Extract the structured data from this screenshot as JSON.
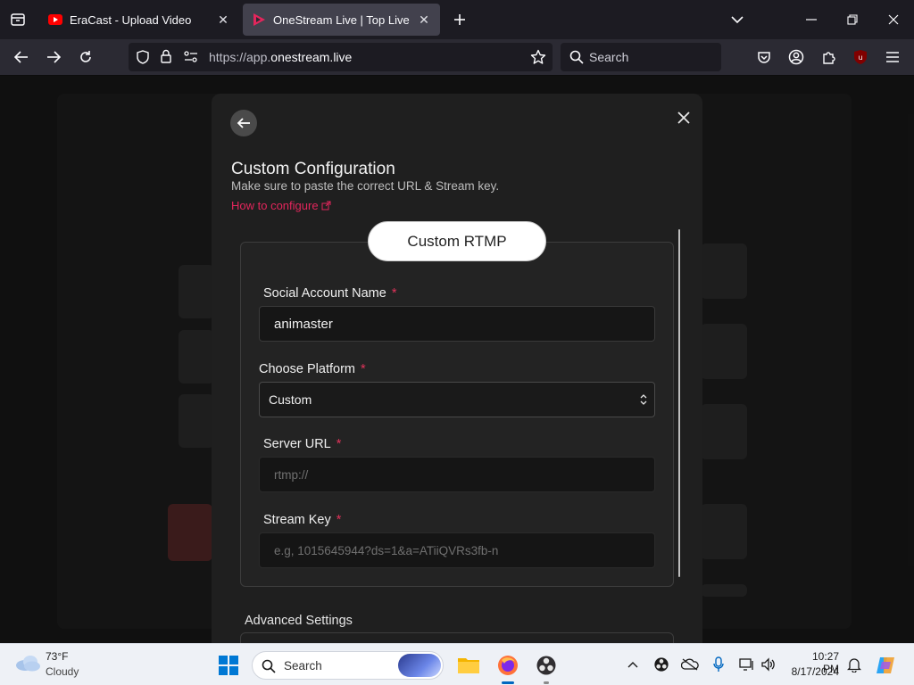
{
  "browser": {
    "tabs": [
      {
        "title": "EraCast - Upload Video",
        "active": false
      },
      {
        "title": "OneStream Live | Top Live Strea",
        "active": true
      }
    ],
    "url_prefix": "https://app.",
    "url_domain": "onestream.live",
    "search_placeholder": "Search",
    "extension_badge": "9"
  },
  "modal": {
    "title": "Custom Configuration",
    "subtitle": "Make sure to paste the correct URL & Stream key.",
    "how_to_link": "How to configure",
    "section_pill": "Custom RTMP",
    "fields": {
      "social_account_name": {
        "label": "Social Account Name",
        "value": "animaster",
        "required_mark": "*"
      },
      "choose_platform": {
        "label": "Choose Platform",
        "value": "Custom",
        "required_mark": "*"
      },
      "server_url": {
        "label": "Server URL",
        "placeholder": "rtmp://",
        "required_mark": "*"
      },
      "stream_key": {
        "label": "Stream Key",
        "placeholder": "e.g, 1015645944?ds=1&a=ATiiQVRs3fb-n",
        "required_mark": "*"
      }
    },
    "advanced_settings": "Advanced Settings"
  },
  "taskbar": {
    "weather_temp": "73°F",
    "weather_desc": "Cloudy",
    "search_label": "Search",
    "clock_time": "10:27 PM",
    "clock_date": "8/17/2024"
  },
  "colors": {
    "accent_red": "#e3265c",
    "modal_bg": "#1f1f1f",
    "browser_bg": "#1c1b22"
  }
}
